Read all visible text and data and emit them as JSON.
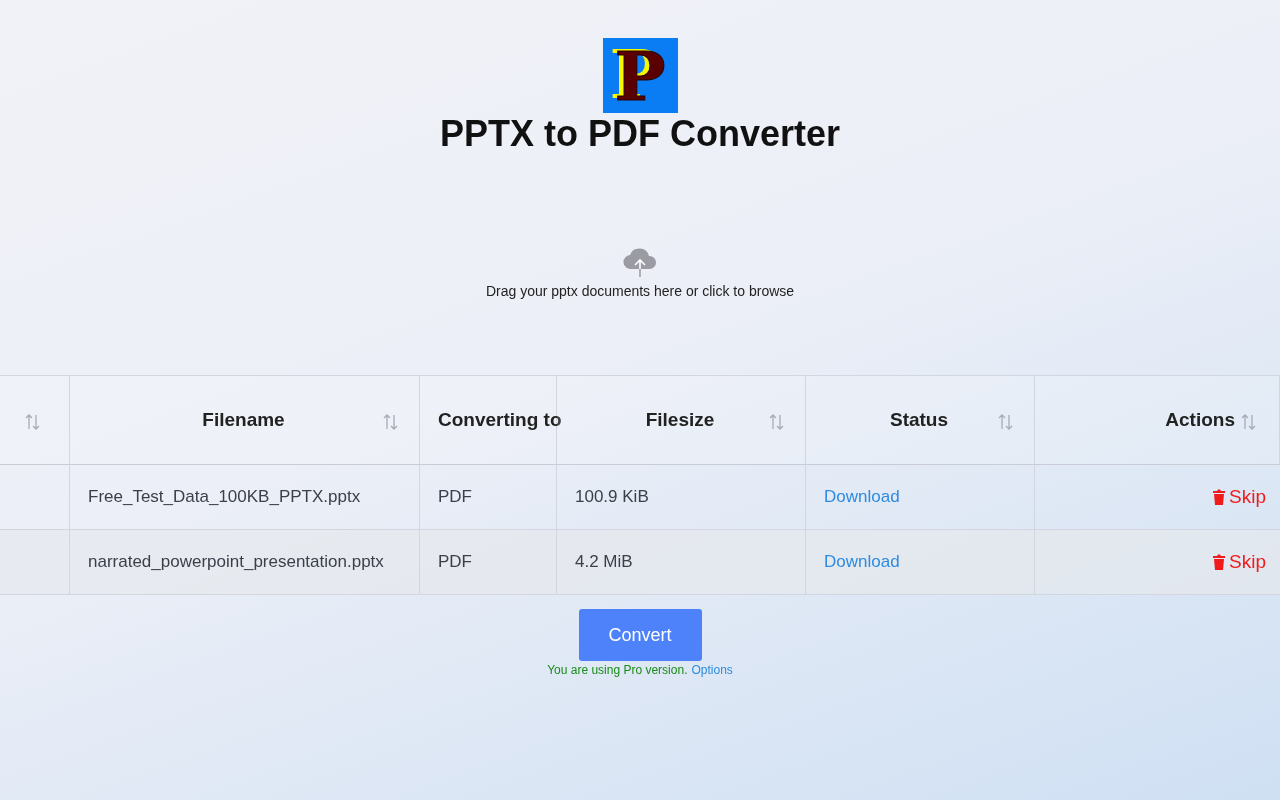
{
  "logo": {
    "letter": "P"
  },
  "title": "PPTX to PDF Converter",
  "dropzone": {
    "text": "Drag your pptx documents here or click to browse"
  },
  "table": {
    "columns": [
      {
        "sortable": true
      },
      {
        "label": "Filename",
        "sortable": true
      },
      {
        "label": "Converting to",
        "sortable": false
      },
      {
        "label": "Filesize",
        "sortable": true
      },
      {
        "label": "Status",
        "sortable": true
      },
      {
        "label": "Actions",
        "sortable": true
      }
    ],
    "rows": [
      {
        "filename": "Free_Test_Data_100KB_PPTX.pptx",
        "target": "PDF",
        "filesize": "100.9 KiB",
        "status": "Download",
        "action": "Skip"
      },
      {
        "filename": "narrated_powerpoint_presentation.pptx",
        "target": "PDF",
        "filesize": "4.2 MiB",
        "status": "Download",
        "action": "Skip"
      }
    ]
  },
  "convert_button": "Convert",
  "footer": {
    "note": "You are using Pro version.",
    "link": "Options"
  }
}
